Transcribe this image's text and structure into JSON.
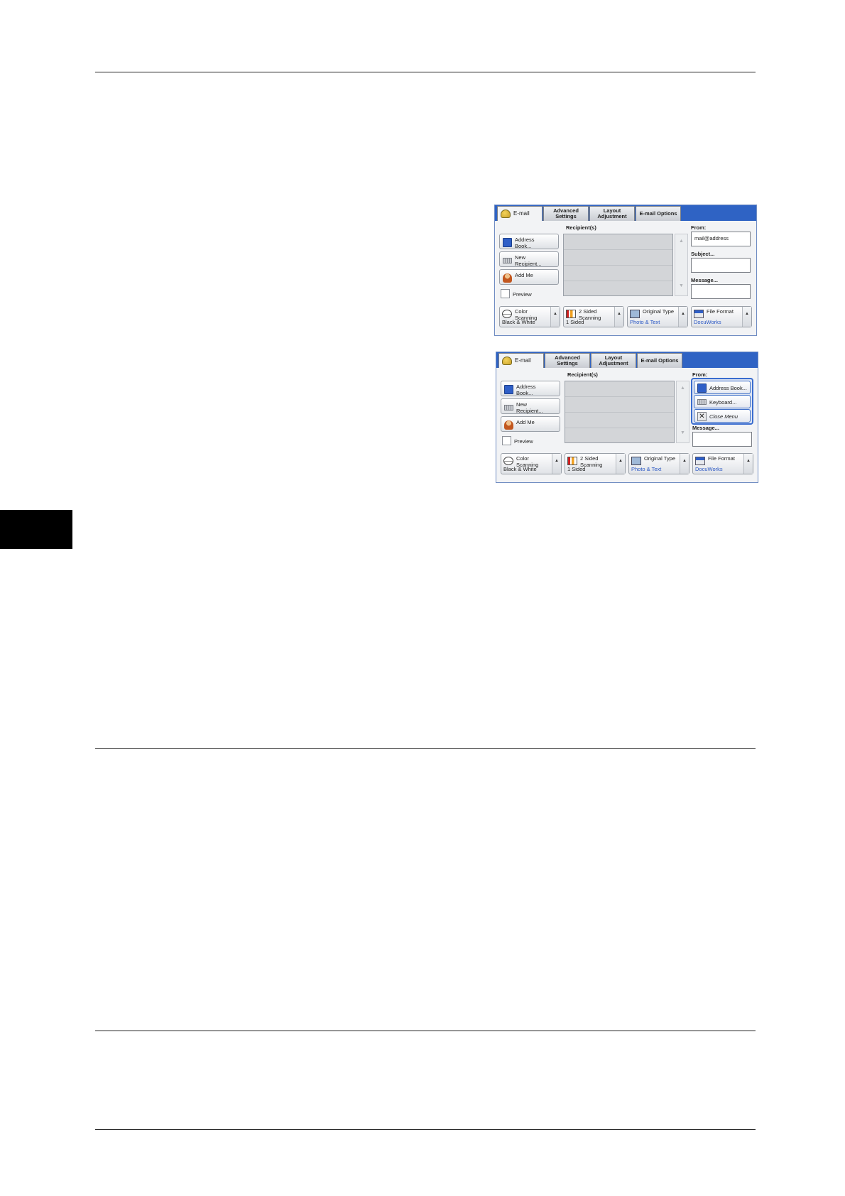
{
  "panels": [
    {
      "tabs": {
        "email": "E-mail",
        "advanced": "Advanced\nSettings",
        "layout": "Layout\nAdjustment",
        "email_options": "E-mail Options"
      },
      "recipients_label": "Recipient(s)",
      "left_buttons": {
        "address_book": "Address\nBook...",
        "new_recipient": "New\nRecipient...",
        "add_me": "Add Me",
        "preview": "Preview"
      },
      "from_label": "From:",
      "from_value": "mail@address",
      "subject_label": "Subject...",
      "message_label": "Message...",
      "features": {
        "color_title": "Color\nScanning",
        "color_value": "Black & White",
        "sided_title": "2 Sided\nScanning",
        "sided_value": "1 Sided",
        "original_title": "Original Type",
        "original_value": "Photo & Text",
        "file_title": "File Format",
        "file_value": "DocuWorks"
      }
    },
    {
      "tabs": {
        "email": "E-mail",
        "advanced": "Advanced\nSettings",
        "layout": "Layout\nAdjustment",
        "email_options": "E-mail Options"
      },
      "recipients_label": "Recipient(s)",
      "left_buttons": {
        "address_book": "Address\nBook...",
        "new_recipient": "New\nRecipient...",
        "add_me": "Add Me",
        "preview": "Preview"
      },
      "from_label": "From:",
      "from_menu": {
        "address_book": "Address Book...",
        "keyboard": "Keyboard...",
        "close_menu": "Close Menu"
      },
      "message_label": "Message...",
      "features": {
        "color_title": "Color\nScanning",
        "color_value": "Black & White",
        "sided_title": "2 Sided\nScanning",
        "sided_value": "1 Sided",
        "original_title": "Original Type",
        "original_value": "Photo & Text",
        "file_title": "File Format",
        "file_value": "DocuWorks"
      }
    }
  ],
  "colors": {
    "tab_bar": "#2f63c4",
    "value_text": "#2a57c4",
    "side_tab": "#000000"
  }
}
